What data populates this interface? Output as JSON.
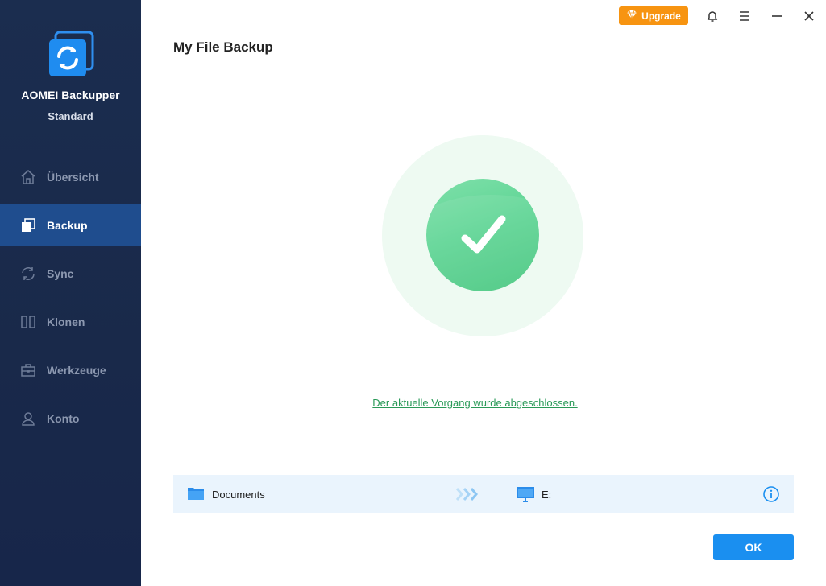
{
  "app": {
    "name": "AOMEI Backupper",
    "edition": "Standard"
  },
  "sidebar": {
    "items": [
      {
        "label": "Übersicht",
        "icon": "home-icon",
        "active": false
      },
      {
        "label": "Backup",
        "icon": "backup-icon",
        "active": true
      },
      {
        "label": "Sync",
        "icon": "sync-icon",
        "active": false
      },
      {
        "label": "Klonen",
        "icon": "clone-icon",
        "active": false
      },
      {
        "label": "Werkzeuge",
        "icon": "toolbox-icon",
        "active": false
      },
      {
        "label": "Konto",
        "icon": "user-icon",
        "active": false
      }
    ]
  },
  "titlebar": {
    "upgrade_label": "Upgrade",
    "icons": [
      "bell-icon",
      "menu-icon",
      "minimize-icon",
      "close-icon"
    ]
  },
  "main": {
    "title": "My File Backup",
    "status_message": "Der aktuelle Vorgang wurde abgeschlossen.",
    "task": {
      "source": "Documents",
      "destination": "E:"
    },
    "ok_label": "OK"
  },
  "colors": {
    "sidebar_bg": "#1b2d4f",
    "active_nav": "#1f4d8e",
    "accent_blue": "#1a8ff0",
    "success_green": "#47c67f",
    "upgrade_orange": "#f79411"
  }
}
